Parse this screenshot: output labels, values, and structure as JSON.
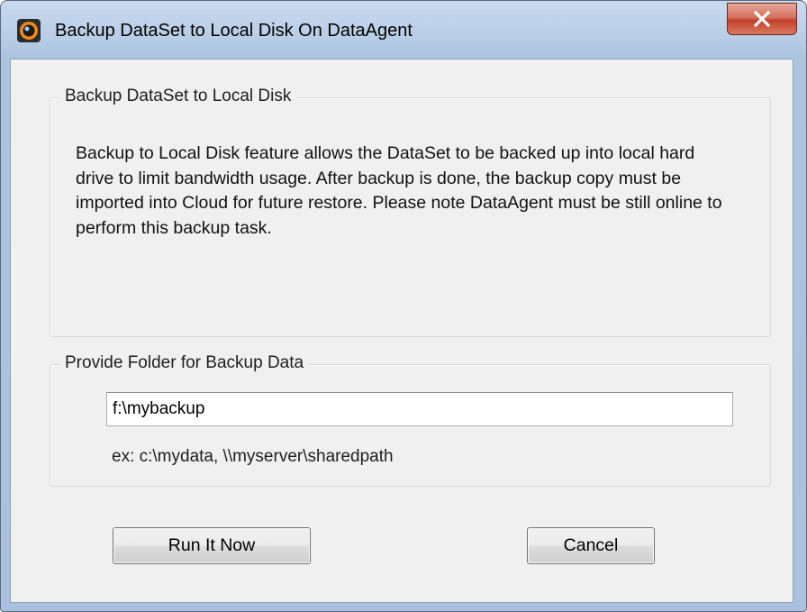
{
  "window": {
    "title": "Backup DataSet to Local Disk On DataAgent",
    "app_icon": "app-logo-icon",
    "close_icon": "close-icon"
  },
  "intro_group": {
    "label": "Backup DataSet to Local Disk",
    "description": "Backup to Local Disk feature allows the DataSet to be backed up into local hard drive to limit bandwidth usage. After backup is done, the backup copy must be imported into Cloud for future restore. Please note DataAgent must be still online to perform this backup task."
  },
  "folder_group": {
    "label": "Provide Folder for Backup Data",
    "folder_value": "f:\\mybackup",
    "example_text": "ex: c:\\mydata, \\\\myserver\\sharedpath"
  },
  "buttons": {
    "run_label": "Run It Now",
    "cancel_label": "Cancel"
  },
  "colors": {
    "title_bar": "#b9cde6",
    "dialog_background": "#f0f0f0",
    "close_button": "#c2412b"
  }
}
